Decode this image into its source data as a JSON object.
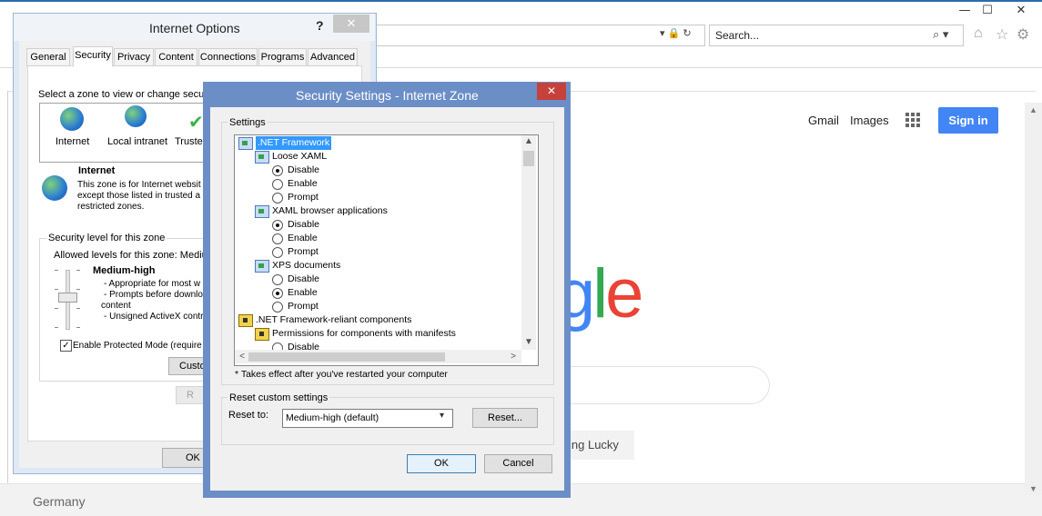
{
  "browser": {
    "search_placeholder": "Search...",
    "window_controls": {
      "minimize": "—",
      "maximize": "☐",
      "close": "✕"
    },
    "address_icons": "▾ 🔒 ↻",
    "search_glyph": "⌕ ▾",
    "icons": {
      "home": "⌂",
      "favorites": "☆",
      "tools": "⚙"
    }
  },
  "google": {
    "gmail": "Gmail",
    "images": "Images",
    "sign_in": "Sign in",
    "logo_tail": [
      {
        "char": "g",
        "color": "#4285f4"
      },
      {
        "char": "l",
        "color": "#34a853"
      },
      {
        "char": "e",
        "color": "#ea4335"
      }
    ],
    "lucky_button": "ing Lucky",
    "country": "Germany",
    "scroll_up": "▲",
    "scroll_down": "▼"
  },
  "internet_options": {
    "title": "Internet Options",
    "help": "?",
    "close": "✕",
    "tabs": [
      "General",
      "Security",
      "Privacy",
      "Content",
      "Connections",
      "Programs",
      "Advanced"
    ],
    "active_tab": "Security",
    "zone_prompt": "Select a zone to view or change security",
    "zones": [
      "Internet",
      "Local intranet",
      "Truste"
    ],
    "zone_name": "Internet",
    "zone_description": "This zone is for Internet websit except those listed in trusted a restricted zones.",
    "security_level_title": "Security level for this zone",
    "allowed_levels": "Allowed levels for this zone: Medium",
    "level_name": "Medium-high",
    "level_bullets": [
      "- Appropriate for most w",
      "- Prompts before downlo",
      "content",
      "- Unsigned ActiveX contr"
    ],
    "protected_mode_checked": "✓",
    "protected_mode_label": "Enable Protected Mode (require",
    "custom_button": "Custo",
    "reset_button": "R",
    "ok_button": "OK"
  },
  "security_settings": {
    "title": "Security Settings - Internet Zone",
    "close": "✕",
    "settings_label": "Settings",
    "tree": [
      {
        "type": "category",
        "label": ".NET Framework",
        "indent": 0,
        "icon": "config",
        "selected": true
      },
      {
        "type": "category",
        "label": "Loose XAML",
        "indent": 1,
        "icon": "config"
      },
      {
        "type": "option",
        "label": "Disable",
        "checked": true
      },
      {
        "type": "option",
        "label": "Enable",
        "checked": false
      },
      {
        "type": "option",
        "label": "Prompt",
        "checked": false
      },
      {
        "type": "category",
        "label": "XAML browser applications",
        "indent": 1,
        "icon": "config"
      },
      {
        "type": "option",
        "label": "Disable",
        "checked": true
      },
      {
        "type": "option",
        "label": "Enable",
        "checked": false
      },
      {
        "type": "option",
        "label": "Prompt",
        "checked": false
      },
      {
        "type": "category",
        "label": "XPS documents",
        "indent": 1,
        "icon": "config"
      },
      {
        "type": "option",
        "label": "Disable",
        "checked": false
      },
      {
        "type": "option",
        "label": "Enable",
        "checked": true
      },
      {
        "type": "option",
        "label": "Prompt",
        "checked": false
      },
      {
        "type": "category",
        "label": ".NET Framework-reliant components",
        "indent": 0,
        "icon": "lock"
      },
      {
        "type": "category",
        "label": "Permissions for components with manifests",
        "indent": 1,
        "icon": "lock"
      },
      {
        "type": "option",
        "label": "Disable",
        "checked": false
      }
    ],
    "note": "* Takes effect after you've restarted your computer",
    "reset_group_label": "Reset custom settings",
    "reset_to_label": "Reset to:",
    "reset_to_value": "Medium-high (default)",
    "reset_button": "Reset...",
    "ok_button": "OK",
    "cancel_button": "Cancel",
    "scroll_up": "▲",
    "scroll_down": "▼",
    "scroll_left": "<",
    "scroll_right": ">",
    "dropdown_arrow": "▾"
  }
}
